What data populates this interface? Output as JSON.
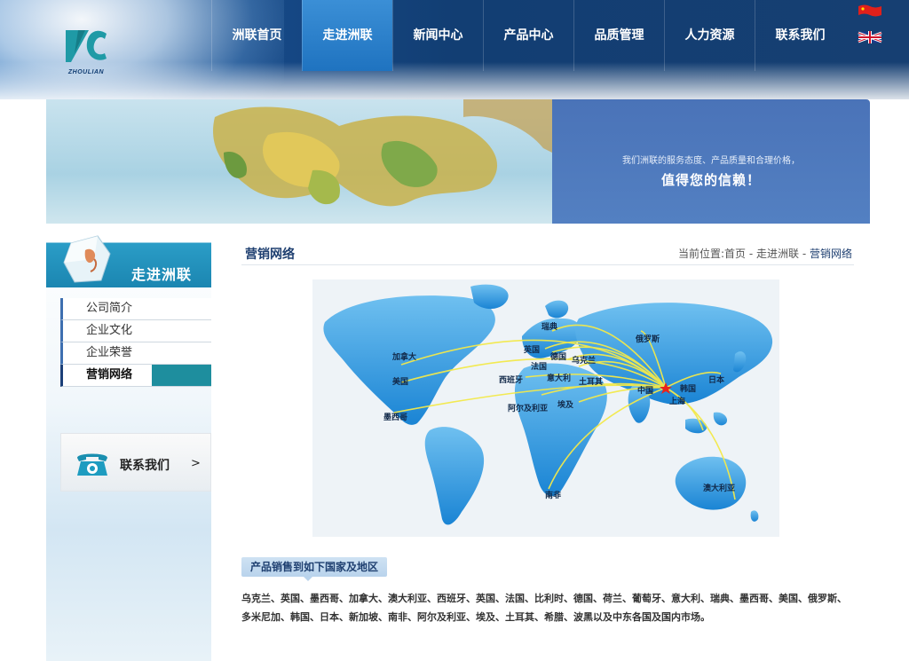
{
  "header": {
    "logo_text": "ZHOULIAN",
    "nav": [
      {
        "label": "洲联首页"
      },
      {
        "label": "走进洲联"
      },
      {
        "label": "新闻中心"
      },
      {
        "label": "产品中心"
      },
      {
        "label": "品质管理"
      },
      {
        "label": "人力资源"
      },
      {
        "label": "联系我们"
      }
    ],
    "active_nav_index": 1,
    "flags": [
      "china-flag-icon",
      "uk-flag-icon"
    ]
  },
  "banner": {
    "line1": "我们洲联的服务态度、产品质量和合理价格，",
    "line2": "值得您的信赖！"
  },
  "sidebar": {
    "title": "走进洲联",
    "items": [
      {
        "label": "公司简介"
      },
      {
        "label": "企业文化"
      },
      {
        "label": "企业荣誉"
      },
      {
        "label": "营销网络"
      }
    ],
    "active_item_index": 3,
    "contact": {
      "label": "联系我们",
      "arrow": ">"
    }
  },
  "main": {
    "title": "营销网络",
    "breadcrumb": {
      "prefix": "当前位置:",
      "home": "首页",
      "sep1": " - ",
      "section": "走进洲联",
      "sep2": " - ",
      "current": "营销网络"
    },
    "map": {
      "labels": {
        "sweden": "瑞典",
        "russia": "俄罗斯",
        "canada": "加拿大",
        "uk": "英国",
        "germany": "德国",
        "ukraine": "乌克兰",
        "france": "法国",
        "spain": "西班牙",
        "italy": "意大利",
        "turkey": "土耳其",
        "usa": "美国",
        "china": "中国",
        "korea": "韩国",
        "japan": "日本",
        "shanghai": "上海",
        "algeria": "阿尔及利亚",
        "egypt": "埃及",
        "mexico": "墨西哥",
        "south_africa": "南非",
        "australia": "澳大利亚"
      }
    },
    "section_tag": "产品销售到如下国家及地区",
    "countries_text": "乌克兰、英国、墨西哥、加拿大、澳大利亚、西班牙、英国、法国、比利时、德国、荷兰、葡萄牙、意大利、瑞典、墨西哥、美国、俄罗斯、多米尼加、韩国、日本、新加坡、南非、阿尔及利亚、埃及、土耳其、希腊、波黑以及中东各国及国内市场。"
  }
}
